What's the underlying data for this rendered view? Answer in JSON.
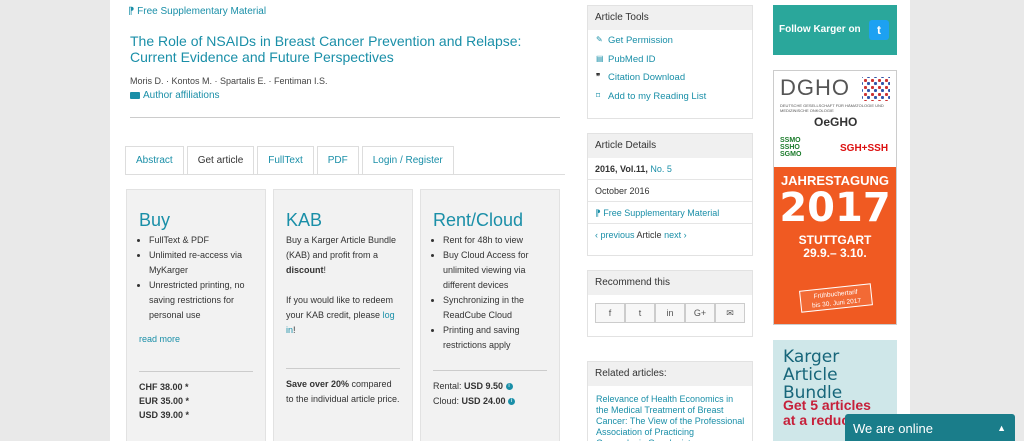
{
  "article": {
    "supp_material": "Free Supplementary Material",
    "title": "The Role of NSAIDs in Breast Cancer Prevention and Relapse: Current Evidence and Future Perspectives",
    "authors": "Moris D. · Kontos M. · Spartalis E. · Fentiman I.S.",
    "affiliations": "Author affiliations"
  },
  "tabs": [
    "Abstract",
    "Get article",
    "FullText",
    "PDF",
    "Login / Register"
  ],
  "active_tab": "Get article",
  "buy": {
    "title": "Buy",
    "items": [
      "FullText & PDF",
      "Unlimited re-access via MyKarger",
      "Unrestricted printing, no saving restrictions for personal use"
    ],
    "read_more": "read more",
    "prices": [
      "CHF 38.00 *",
      "EUR 35.00 *",
      "USD 39.00 *"
    ]
  },
  "kab": {
    "title": "KAB",
    "text1": "Buy a Karger Article Bundle (KAB) and profit from a",
    "discount": "discount",
    "text1_end": "!",
    "text2": "If you would like to redeem your KAB credit, please",
    "login": "log in",
    "text2_end": ".",
    "save_bold": "Save over 20%",
    "save_rest": " compared to the individual article price."
  },
  "rent": {
    "title": "Rent/Cloud",
    "items": [
      "Rent for 48h to view",
      "Buy Cloud Access for unlimited viewing via different devices",
      "Synchronizing in the ReadCube Cloud",
      "Printing and saving restrictions apply"
    ],
    "rental_label": "Rental:",
    "rental_price": "USD 9.50",
    "cloud_label": "Cloud:",
    "cloud_price": "USD 24.00"
  },
  "tools": {
    "title": "Article Tools",
    "items": [
      {
        "label": "Get Permission",
        "icon": "permission-icon"
      },
      {
        "label": "PubMed ID",
        "icon": "pubmed-icon"
      },
      {
        "label": "Citation Download",
        "icon": "quote-icon"
      },
      {
        "label": "Add to my Reading List",
        "icon": "bookmark-icon"
      }
    ]
  },
  "details": {
    "title": "Article Details",
    "volume": "2016, Vol.11,",
    "issue": "No. 5",
    "date": "October 2016",
    "supp": "Free Supplementary Material",
    "previous": "previous",
    "article": "Article",
    "next": "next"
  },
  "recommend": {
    "title": "Recommend this",
    "buttons": [
      "facebook-icon",
      "twitter-icon",
      "linkedin-icon",
      "googleplus-icon",
      "email-icon"
    ],
    "glyphs": [
      "f",
      "t",
      "in",
      "G+",
      "✉"
    ]
  },
  "related": {
    "title": "Related articles:",
    "first": "Relevance of Health Economics in the Medical Treatment of Breast Cancer: The View of the Professional Association of Practicing Gynecologic Oncologists"
  },
  "ads": {
    "twitter": "Follow Karger on",
    "dgho_logo": "DGHO",
    "dgho_sub": "DEUTSCHE GESELLSCHAFT FÜR HÄMATOLOGIE UND MEDIZINISCHE ONKOLOGIE",
    "ogho": "OeGHO",
    "ssmo": "SSMO",
    "sssh": "SSHO",
    "sgmo": "SGMO",
    "sgh": "SGH+SSH",
    "jahrestagung": "JAHRESTAGUNG",
    "year": "2017",
    "city": "STUTTGART",
    "dates": "29.9.– 3.10.",
    "badge1": "Frühbuchertarif",
    "badge2": "bis 30. Juni 2017",
    "kab1": "Karger",
    "kab2": "Article Bundle",
    "kab3": "Get 5 articles",
    "kab4": "at a reduced"
  },
  "chat": {
    "label": "We are online"
  }
}
